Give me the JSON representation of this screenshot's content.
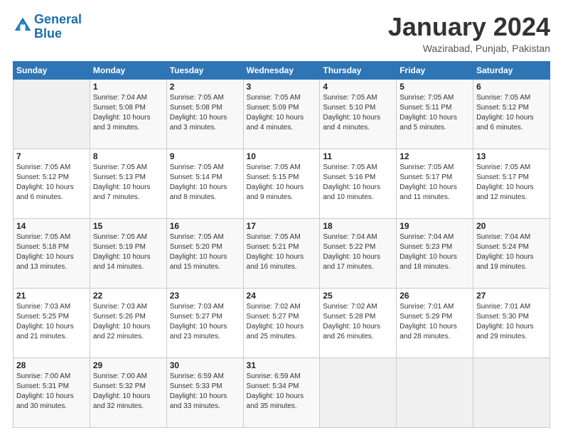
{
  "header": {
    "logo_line1": "General",
    "logo_line2": "Blue",
    "title": "January 2024",
    "subtitle": "Wazirabad, Punjab, Pakistan"
  },
  "columns": [
    "Sunday",
    "Monday",
    "Tuesday",
    "Wednesday",
    "Thursday",
    "Friday",
    "Saturday"
  ],
  "weeks": [
    [
      {
        "day": "",
        "sunrise": "",
        "sunset": "",
        "daylight": ""
      },
      {
        "day": "1",
        "sunrise": "Sunrise: 7:04 AM",
        "sunset": "Sunset: 5:08 PM",
        "daylight": "Daylight: 10 hours and 3 minutes."
      },
      {
        "day": "2",
        "sunrise": "Sunrise: 7:05 AM",
        "sunset": "Sunset: 5:08 PM",
        "daylight": "Daylight: 10 hours and 3 minutes."
      },
      {
        "day": "3",
        "sunrise": "Sunrise: 7:05 AM",
        "sunset": "Sunset: 5:09 PM",
        "daylight": "Daylight: 10 hours and 4 minutes."
      },
      {
        "day": "4",
        "sunrise": "Sunrise: 7:05 AM",
        "sunset": "Sunset: 5:10 PM",
        "daylight": "Daylight: 10 hours and 4 minutes."
      },
      {
        "day": "5",
        "sunrise": "Sunrise: 7:05 AM",
        "sunset": "Sunset: 5:11 PM",
        "daylight": "Daylight: 10 hours and 5 minutes."
      },
      {
        "day": "6",
        "sunrise": "Sunrise: 7:05 AM",
        "sunset": "Sunset: 5:12 PM",
        "daylight": "Daylight: 10 hours and 6 minutes."
      }
    ],
    [
      {
        "day": "7",
        "sunrise": "Sunrise: 7:05 AM",
        "sunset": "Sunset: 5:12 PM",
        "daylight": "Daylight: 10 hours and 6 minutes."
      },
      {
        "day": "8",
        "sunrise": "Sunrise: 7:05 AM",
        "sunset": "Sunset: 5:13 PM",
        "daylight": "Daylight: 10 hours and 7 minutes."
      },
      {
        "day": "9",
        "sunrise": "Sunrise: 7:05 AM",
        "sunset": "Sunset: 5:14 PM",
        "daylight": "Daylight: 10 hours and 8 minutes."
      },
      {
        "day": "10",
        "sunrise": "Sunrise: 7:05 AM",
        "sunset": "Sunset: 5:15 PM",
        "daylight": "Daylight: 10 hours and 9 minutes."
      },
      {
        "day": "11",
        "sunrise": "Sunrise: 7:05 AM",
        "sunset": "Sunset: 5:16 PM",
        "daylight": "Daylight: 10 hours and 10 minutes."
      },
      {
        "day": "12",
        "sunrise": "Sunrise: 7:05 AM",
        "sunset": "Sunset: 5:17 PM",
        "daylight": "Daylight: 10 hours and 11 minutes."
      },
      {
        "day": "13",
        "sunrise": "Sunrise: 7:05 AM",
        "sunset": "Sunset: 5:17 PM",
        "daylight": "Daylight: 10 hours and 12 minutes."
      }
    ],
    [
      {
        "day": "14",
        "sunrise": "Sunrise: 7:05 AM",
        "sunset": "Sunset: 5:18 PM",
        "daylight": "Daylight: 10 hours and 13 minutes."
      },
      {
        "day": "15",
        "sunrise": "Sunrise: 7:05 AM",
        "sunset": "Sunset: 5:19 PM",
        "daylight": "Daylight: 10 hours and 14 minutes."
      },
      {
        "day": "16",
        "sunrise": "Sunrise: 7:05 AM",
        "sunset": "Sunset: 5:20 PM",
        "daylight": "Daylight: 10 hours and 15 minutes."
      },
      {
        "day": "17",
        "sunrise": "Sunrise: 7:05 AM",
        "sunset": "Sunset: 5:21 PM",
        "daylight": "Daylight: 10 hours and 16 minutes."
      },
      {
        "day": "18",
        "sunrise": "Sunrise: 7:04 AM",
        "sunset": "Sunset: 5:22 PM",
        "daylight": "Daylight: 10 hours and 17 minutes."
      },
      {
        "day": "19",
        "sunrise": "Sunrise: 7:04 AM",
        "sunset": "Sunset: 5:23 PM",
        "daylight": "Daylight: 10 hours and 18 minutes."
      },
      {
        "day": "20",
        "sunrise": "Sunrise: 7:04 AM",
        "sunset": "Sunset: 5:24 PM",
        "daylight": "Daylight: 10 hours and 19 minutes."
      }
    ],
    [
      {
        "day": "21",
        "sunrise": "Sunrise: 7:03 AM",
        "sunset": "Sunset: 5:25 PM",
        "daylight": "Daylight: 10 hours and 21 minutes."
      },
      {
        "day": "22",
        "sunrise": "Sunrise: 7:03 AM",
        "sunset": "Sunset: 5:26 PM",
        "daylight": "Daylight: 10 hours and 22 minutes."
      },
      {
        "day": "23",
        "sunrise": "Sunrise: 7:03 AM",
        "sunset": "Sunset: 5:27 PM",
        "daylight": "Daylight: 10 hours and 23 minutes."
      },
      {
        "day": "24",
        "sunrise": "Sunrise: 7:02 AM",
        "sunset": "Sunset: 5:27 PM",
        "daylight": "Daylight: 10 hours and 25 minutes."
      },
      {
        "day": "25",
        "sunrise": "Sunrise: 7:02 AM",
        "sunset": "Sunset: 5:28 PM",
        "daylight": "Daylight: 10 hours and 26 minutes."
      },
      {
        "day": "26",
        "sunrise": "Sunrise: 7:01 AM",
        "sunset": "Sunset: 5:29 PM",
        "daylight": "Daylight: 10 hours and 28 minutes."
      },
      {
        "day": "27",
        "sunrise": "Sunrise: 7:01 AM",
        "sunset": "Sunset: 5:30 PM",
        "daylight": "Daylight: 10 hours and 29 minutes."
      }
    ],
    [
      {
        "day": "28",
        "sunrise": "Sunrise: 7:00 AM",
        "sunset": "Sunset: 5:31 PM",
        "daylight": "Daylight: 10 hours and 30 minutes."
      },
      {
        "day": "29",
        "sunrise": "Sunrise: 7:00 AM",
        "sunset": "Sunset: 5:32 PM",
        "daylight": "Daylight: 10 hours and 32 minutes."
      },
      {
        "day": "30",
        "sunrise": "Sunrise: 6:59 AM",
        "sunset": "Sunset: 5:33 PM",
        "daylight": "Daylight: 10 hours and 33 minutes."
      },
      {
        "day": "31",
        "sunrise": "Sunrise: 6:59 AM",
        "sunset": "Sunset: 5:34 PM",
        "daylight": "Daylight: 10 hours and 35 minutes."
      },
      {
        "day": "",
        "sunrise": "",
        "sunset": "",
        "daylight": ""
      },
      {
        "day": "",
        "sunrise": "",
        "sunset": "",
        "daylight": ""
      },
      {
        "day": "",
        "sunrise": "",
        "sunset": "",
        "daylight": ""
      }
    ]
  ]
}
